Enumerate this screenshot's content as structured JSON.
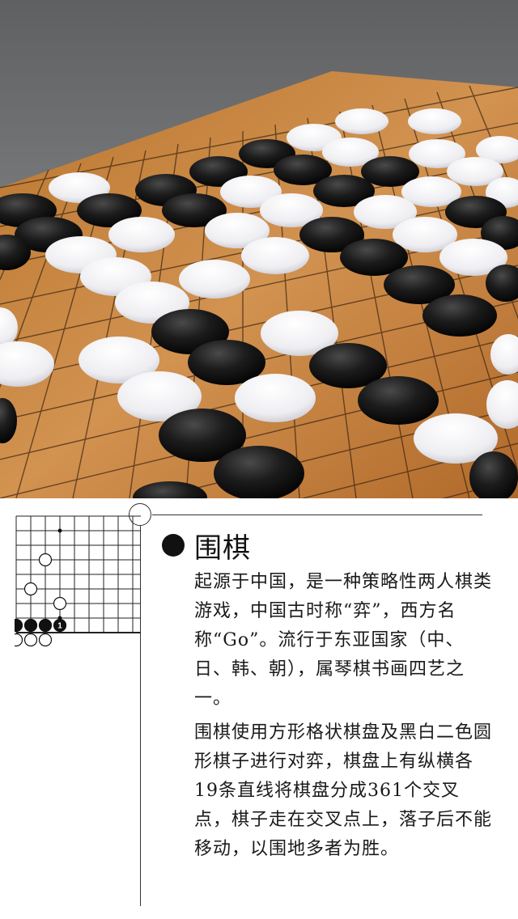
{
  "article": {
    "title": "围棋",
    "paragraphs": [
      "起源于中国，是一种策略性两人棋类游戏，中国古时称“弈”，西方名称“Go”。流行于东亚国家（中、日、韩、朝），属琴棋书画四艺之一。",
      "围棋使用方形格状棋盘及黑白二色圆形棋子进行对弈，棋盘上有纵横各19条直线将棋盘分成361个交叉点，棋子走在交叉点上，落子后不能移动，以围地多者为胜。"
    ],
    "diagram_stone_label": "1"
  },
  "colors": {
    "black_stone": "#111111",
    "white_stone": "#ffffff",
    "board_wood": "#c98a45",
    "text": "#1a1a1a"
  }
}
